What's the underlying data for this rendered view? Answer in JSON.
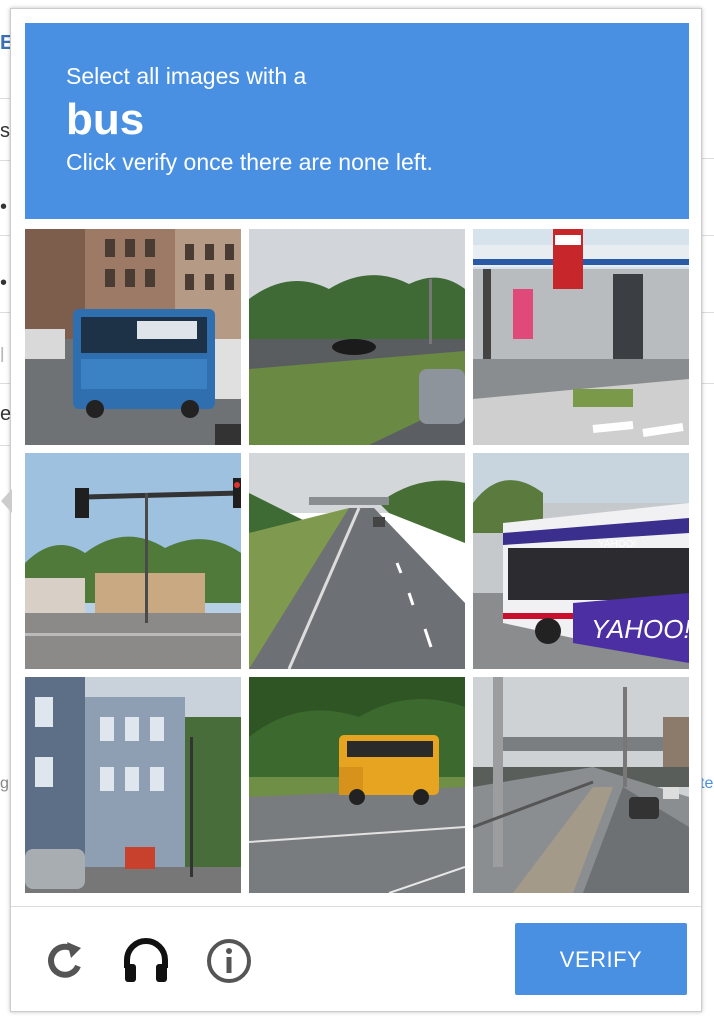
{
  "challenge": {
    "instruction_line1": "Select all images with a",
    "keyword": "bus",
    "instruction_line3": "Click verify once there are none left.",
    "header_color": "#4a90e2",
    "tiles": [
      {
        "scene": "city street with blue transit bus",
        "contains_target": true
      },
      {
        "scene": "divided highway with trees and cars",
        "contains_target": false
      },
      {
        "scene": "gas station at intersection",
        "contains_target": false
      },
      {
        "scene": "traffic light over street with storefronts",
        "contains_target": false
      },
      {
        "scene": "empty highway under overpass",
        "contains_target": false
      },
      {
        "scene": "white and purple city bus with YAHOO! ad",
        "contains_target": true
      },
      {
        "scene": "residential street with row houses",
        "contains_target": false
      },
      {
        "scene": "yellow school bus on road",
        "contains_target": true
      },
      {
        "scene": "expressway beside rail tracks",
        "contains_target": false
      }
    ],
    "bus_ad_text": "YAHOO!",
    "bus_side_text": "YAHOO!"
  },
  "footer": {
    "reload_icon": "reload-icon",
    "audio_icon": "headphones-icon",
    "info_icon": "info-icon",
    "verify_label": "VERIFY",
    "verify_color": "#4a90e2"
  },
  "background_page": {
    "fragments": [
      "E",
      "si",
      "•",
      "•",
      "l",
      "er",
      "g",
      "te"
    ]
  }
}
